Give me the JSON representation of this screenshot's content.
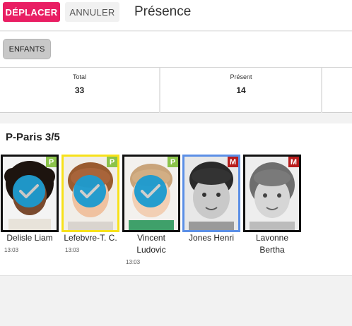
{
  "toolbar": {
    "move_label": "DÉPLACER",
    "cancel_label": "ANNULER",
    "title": "Présence"
  },
  "filter": {
    "children_label": "ENFANTS"
  },
  "stats": {
    "total_label": "Total",
    "total_value": "33",
    "present_label": "Présent",
    "present_value": "14"
  },
  "group": {
    "title": "P-Paris 3/5",
    "children": [
      {
        "name": "Delisle Liam",
        "time": "13:03",
        "status": "P",
        "checked": true,
        "frame": "#111111"
      },
      {
        "name": "Lefebvre-T. C.",
        "time": "13:03",
        "status": "P",
        "checked": true,
        "frame": "#f7e11a"
      },
      {
        "name": "Vincent Ludovic",
        "time": "13:03",
        "status": "P",
        "checked": true,
        "frame": "#111111"
      },
      {
        "name": "Jones Henri",
        "time": "",
        "status": "M",
        "checked": false,
        "frame": "#5b8fe6"
      },
      {
        "name": "Lavonne Bertha",
        "time": "",
        "status": "M",
        "checked": false,
        "frame": "#111111"
      }
    ]
  },
  "colors": {
    "primary": "#e91e63",
    "present_badge": "#8bc34a",
    "absent_badge": "#b71c1c",
    "check": "#1b9bd0"
  },
  "icons": {
    "check": "check-circle-icon"
  }
}
